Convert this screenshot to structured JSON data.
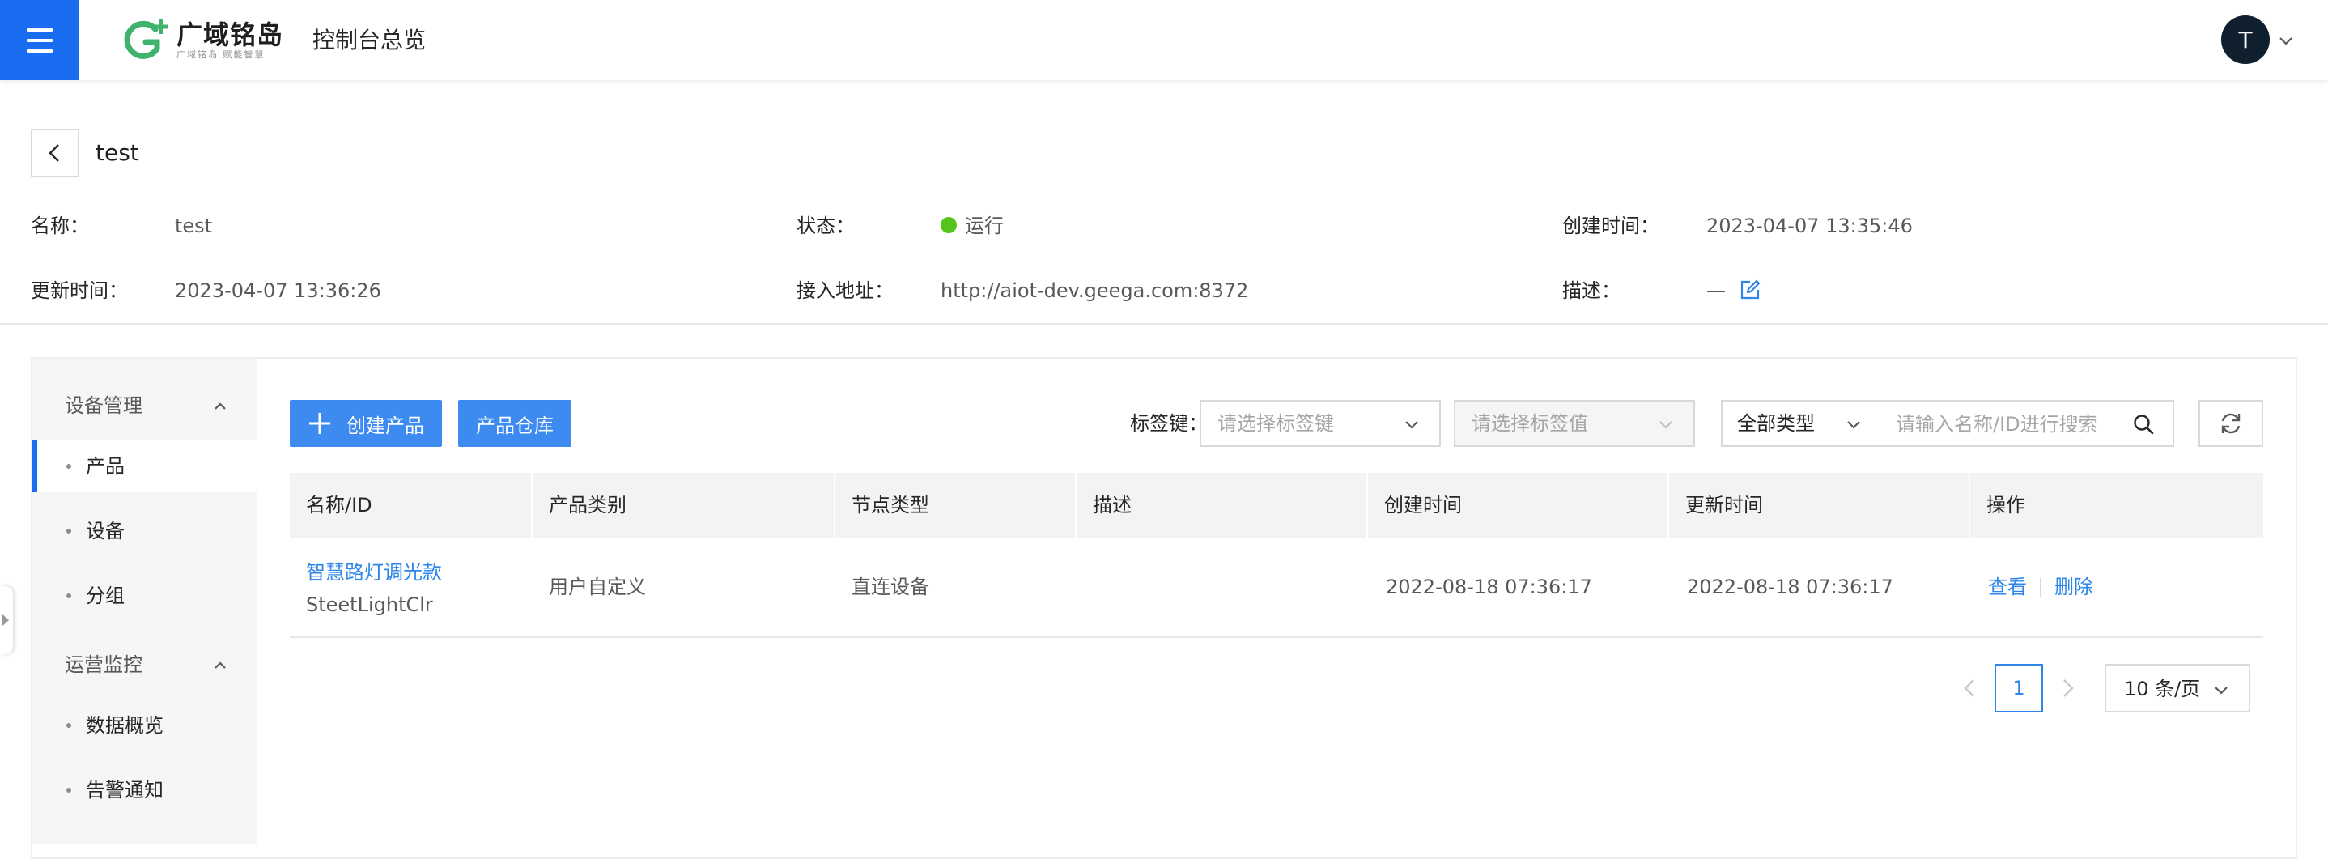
{
  "topbar": {
    "menu_icon": "hamburger-menu-icon",
    "logo_name": "广域铭岛",
    "logo_slogan": "广域铭岛  赋能智慧",
    "brand_green": "#3fb26b",
    "title": "控制台总览",
    "avatar_initial": "T"
  },
  "header": {
    "back_icon": "chevron-left-icon",
    "title": "test"
  },
  "info": {
    "name_label": "名称：",
    "name_value": "test",
    "status_label": "状态：",
    "status_value": "运行",
    "status_color": "#52c41a",
    "created_label": "创建时间：",
    "created_value": "2023-04-07 13:35:46",
    "updated_label": "更新时间：",
    "updated_value": "2023-04-07 13:36:26",
    "address_label": "接入地址：",
    "address_value": "http://aiot-dev.geega.com:8372",
    "desc_label": "描述：",
    "desc_value": "—"
  },
  "sidebar": {
    "groups": [
      {
        "label": "设备管理",
        "items": [
          "产品",
          "设备",
          "分组"
        ]
      },
      {
        "label": "运营监控",
        "items": [
          "数据概览",
          "告警通知"
        ]
      }
    ],
    "active_item": "产品"
  },
  "toolbar": {
    "create_label": "创建产品",
    "warehouse_label": "产品仓库",
    "tag_key_label": "标签键：",
    "tag_key_placeholder": "请选择标签键",
    "tag_value_placeholder": "请选择标签值",
    "type_select_value": "全部类型",
    "search_placeholder": "请输入名称/ID进行搜索"
  },
  "table": {
    "columns": [
      "名称/ID",
      "产品类别",
      "节点类型",
      "描述",
      "创建时间",
      "更新时间",
      "操作"
    ],
    "rows": [
      {
        "name": "智慧路灯调光款",
        "id": "SteetLightClr",
        "category": "用户自定义",
        "node_type": "直连设备",
        "description": "",
        "created": "2022-08-18 07:36:17",
        "updated": "2022-08-18 07:36:17",
        "actions": [
          "查看",
          "删除"
        ]
      }
    ]
  },
  "pagination": {
    "current_page": "1",
    "page_size": "10 条/页"
  },
  "colors": {
    "primary": "#1a6cf0",
    "button": "#3d8bf0",
    "link": "#2f86ea"
  }
}
